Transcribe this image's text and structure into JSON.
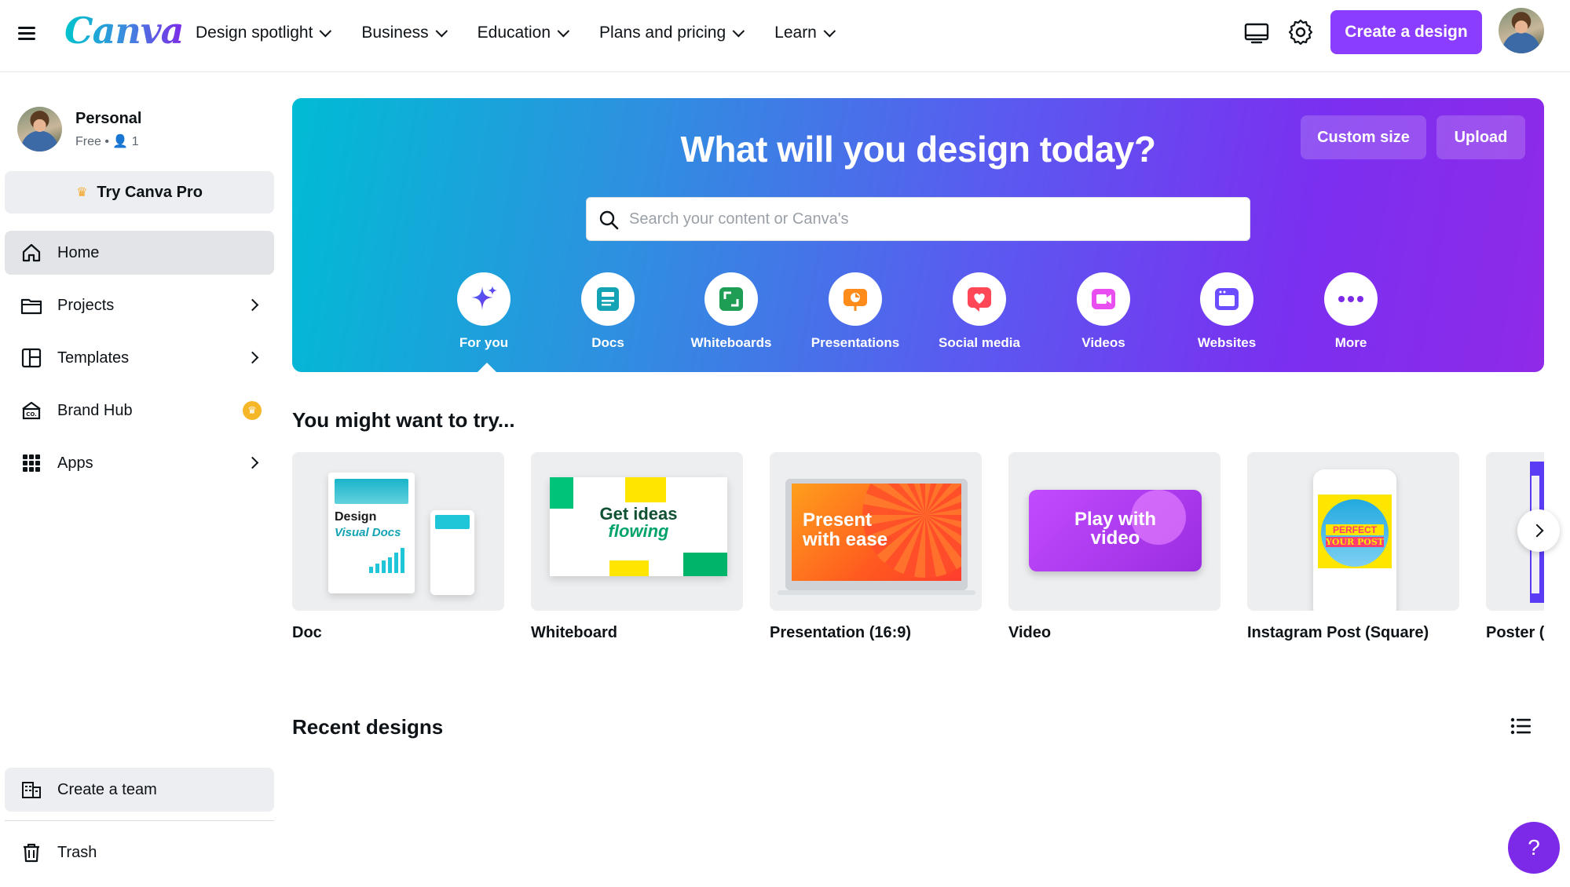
{
  "nav": {
    "logo": "Canva",
    "menu": [
      {
        "label": "Design spotlight"
      },
      {
        "label": "Business"
      },
      {
        "label": "Education"
      },
      {
        "label": "Plans and pricing"
      },
      {
        "label": "Learn"
      }
    ],
    "create_label": "Create a design"
  },
  "sidebar": {
    "profile_name": "Personal",
    "profile_plan": "Free • 👤 1",
    "try_pro": "Try Canva Pro",
    "items": [
      {
        "label": "Home"
      },
      {
        "label": "Projects"
      },
      {
        "label": "Templates"
      },
      {
        "label": "Brand Hub"
      },
      {
        "label": "Apps"
      }
    ],
    "create_team": "Create a team",
    "trash": "Trash"
  },
  "hero": {
    "title": "What will you design today?",
    "custom_size": "Custom size",
    "upload": "Upload",
    "search_placeholder": "Search your content or Canva's",
    "categories": [
      {
        "label": "For you"
      },
      {
        "label": "Docs"
      },
      {
        "label": "Whiteboards"
      },
      {
        "label": "Presentations"
      },
      {
        "label": "Social media"
      },
      {
        "label": "Videos"
      },
      {
        "label": "Websites"
      },
      {
        "label": "More"
      }
    ]
  },
  "try": {
    "title": "You might want to try...",
    "cards": [
      {
        "label": "Doc",
        "art_title": "Design",
        "art_sub": "Visual Docs"
      },
      {
        "label": "Whiteboard",
        "art_title": "Get ideas",
        "art_sub": "flowing"
      },
      {
        "label": "Presentation (16:9)",
        "art_title": "Present",
        "art_sub": "with ease"
      },
      {
        "label": "Video",
        "art_title": "Play with",
        "art_sub": "video"
      },
      {
        "label": "Instagram Post (Square)",
        "art_title": "PERFECT",
        "art_sub": "YOUR POST"
      },
      {
        "label": "Poster ("
      }
    ]
  },
  "recent": {
    "title": "Recent designs"
  },
  "help_label": "?",
  "colors": {
    "brand_purple": "#8b3dff",
    "hero_start": "#00bcd4",
    "hero_end": "#8f2ae8"
  }
}
